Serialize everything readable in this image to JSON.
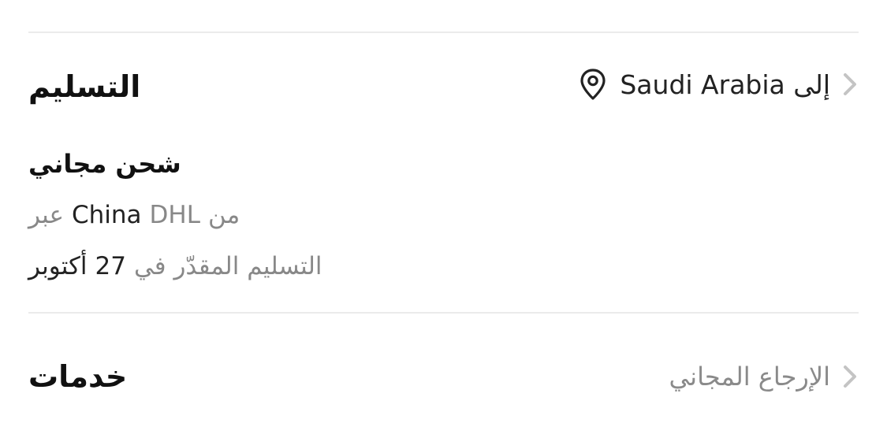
{
  "delivery": {
    "title": "التسليم",
    "destination_prefix": "إلى",
    "destination_country": "Saudi Arabia",
    "shipping_label": "شحن مجاني",
    "via_word": "عبر",
    "origin": "China",
    "carrier": "DHL",
    "from_word": "من",
    "estimate_prefix": "التسليم المقدّر في",
    "estimate_day": "27",
    "estimate_month": "أكتوبر"
  },
  "services": {
    "title": "خدمات",
    "free_returns": "الإرجاع المجاني"
  },
  "colors": {
    "primary_text": "#111111",
    "secondary_text": "#888888",
    "divider": "#ebebeb",
    "chevron": "#c4c4c4"
  },
  "icons": [
    "location-pin-icon",
    "chevron-right-icon"
  ]
}
